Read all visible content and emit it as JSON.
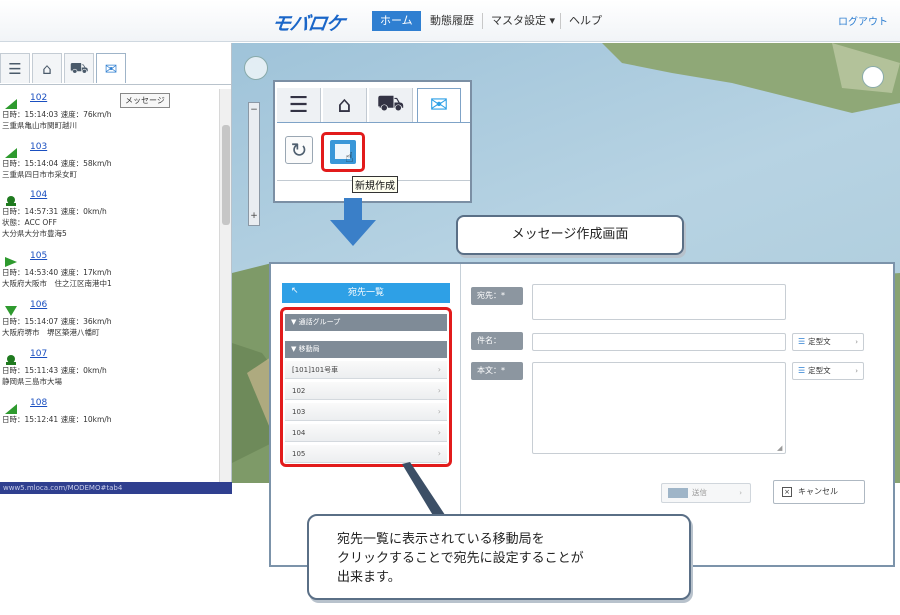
{
  "header": {
    "logo": "モバロケ",
    "nav": [
      {
        "label": "ホーム",
        "active": true
      },
      {
        "label": "動態履歴"
      },
      {
        "label": "マスタ設定 ▾"
      },
      {
        "label": "ヘルプ"
      }
    ],
    "logout": "ログアウト"
  },
  "left_panel": {
    "tooltip": "メッセージ",
    "vehicles": [
      {
        "id": "102",
        "line1": "日時：15:14:03 速度：76km/h",
        "line2": "三重県亀山市関町越川",
        "icon_color": "#2e9a2e"
      },
      {
        "id": "103",
        "line1": "日時：15:14:04 速度：58km/h",
        "line2": "三重県四日市市采女町",
        "icon_color": "#2e9a2e"
      },
      {
        "id": "104",
        "line1": "日時：14:57:31 速度：0km/h",
        "line2": "状態：ACC OFF",
        "line3": "大分県大分市豊海5",
        "icon_color": "#1f7a1f"
      },
      {
        "id": "105",
        "line1": "日時：14:53:40 速度：17km/h",
        "line2": "大阪府大阪市　住之江区南港中1",
        "icon_color": "#2e9a2e"
      },
      {
        "id": "106",
        "line1": "日時：15:14:07 速度：36km/h",
        "line2": "大阪府堺市　堺区築港八幡町",
        "icon_color": "#2e9a2e"
      },
      {
        "id": "107",
        "line1": "日時：15:11:43 速度：0km/h",
        "line2": "静岡県三島市大場",
        "icon_color": "#1f7a1f"
      },
      {
        "id": "108",
        "line1": "日時：15:12:41 速度：10km/h",
        "line2": "",
        "icon_color": "#2e9a2e"
      }
    ],
    "status_url": "www5.mloca.com/MODEMO#tab4"
  },
  "toolbar_callout": {
    "tooltip": "新規作成"
  },
  "screen_label": "メッセージ作成画面",
  "message_screen": {
    "dest_list_header": "宛先一覧",
    "group_header": "▼ 通話グループ",
    "mobile_header": "▼ 移動局",
    "destinations": [
      "[101]101号車",
      "102",
      "103",
      "104",
      "105"
    ],
    "to_label": "宛先：*",
    "subject_label": "件名：",
    "body_label": "本文：*",
    "template_label": "定型文",
    "send_label": "送信",
    "cancel_label": "キャンセル"
  },
  "note": {
    "lines": [
      "宛先一覧に表示されている移動局を",
      "クリックすることで宛先に設定することが",
      "出来ます。"
    ]
  },
  "colors": {
    "highlight": "#e21b1b",
    "accent": "#2ea0e6",
    "arrow": "#3a7fc8"
  }
}
